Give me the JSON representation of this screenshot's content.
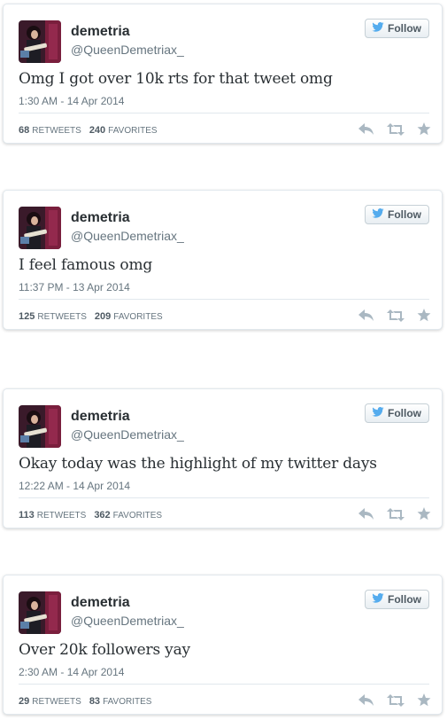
{
  "follow_label": "Follow",
  "retweets_label": "RETWEETS",
  "favorites_label": "FAVORITES",
  "tweets": [
    {
      "name": "demetria",
      "handle": "@QueenDemetriax_",
      "text": "Omg I got over 10k rts for that tweet omg",
      "time": "1:30 AM - 14 Apr 2014",
      "retweets": "68",
      "favorites": "240"
    },
    {
      "name": "demetria",
      "handle": "@QueenDemetriax_",
      "text": "I feel famous omg",
      "time": "11:37 PM - 13 Apr 2014",
      "retweets": "125",
      "favorites": "209"
    },
    {
      "name": "demetria",
      "handle": "@QueenDemetriax_",
      "text": "Okay today was the highlight of my twitter days",
      "time": "12:22 AM - 14 Apr 2014",
      "retweets": "113",
      "favorites": "362"
    },
    {
      "name": "demetria",
      "handle": "@QueenDemetriax_",
      "text": "Over 20k followers yay",
      "time": "2:30 AM - 14 Apr 2014",
      "retweets": "29",
      "favorites": "83"
    }
  ],
  "colors": {
    "twitter_blue": "#55acee",
    "icon_gray": "#aab8c2"
  },
  "icons": [
    "twitter-bird-icon",
    "reply-icon",
    "retweet-icon",
    "favorite-icon"
  ]
}
